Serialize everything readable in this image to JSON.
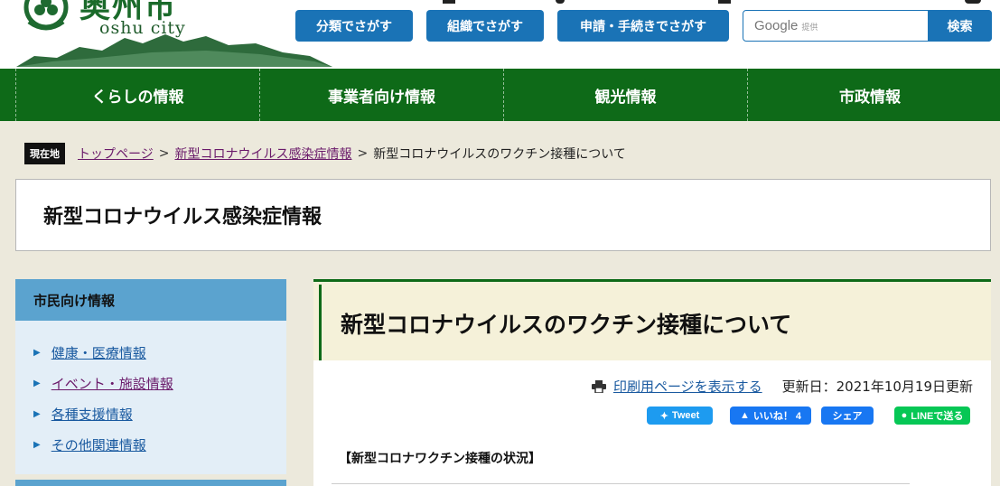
{
  "header": {
    "logo_kanji": "奥州市",
    "logo_sub": "oshu city",
    "top_buttons": [
      "分類でさがす",
      "組織でさがす",
      "申請・手続きでさがす"
    ],
    "search": {
      "google_label": "Google",
      "google_sub": "提供",
      "button": "検索"
    }
  },
  "nav": [
    "くらしの情報",
    "事業者向け情報",
    "観光情報",
    "市政情報"
  ],
  "breadcrumb": {
    "label": "現在地",
    "items": [
      "トップページ",
      "新型コロナウイルス感染症情報",
      "新型コロナウイルスのワクチン接種について"
    ],
    "sep": ">"
  },
  "section_title": "新型コロナウイルス感染症情報",
  "sidebar": {
    "heading": "市民向け情報",
    "items": [
      "健康・医療情報",
      "イベント・施設情報",
      "各種支援情報",
      "その他関連情報"
    ]
  },
  "main": {
    "title": "新型コロナウイルスのワクチン接種について",
    "print_link": "印刷用ページを表示する",
    "updated": "更新日：2021年10月19日更新",
    "social": {
      "tweet": "Tweet",
      "like": "いいね！ 4",
      "share": "シェア",
      "line": "LINEで送る"
    },
    "body_heading": "【新型コロナワクチン接種の状況】"
  },
  "colors": {
    "green": "#0e6a18",
    "blue": "#1a73b6",
    "sidebar_head": "#5ba3cf",
    "title_bg": "#f5f1d9"
  },
  "icons": [
    "city-emblem-icon",
    "printer-icon",
    "twitter-icon",
    "thumbs-up-icon",
    "line-icon"
  ]
}
